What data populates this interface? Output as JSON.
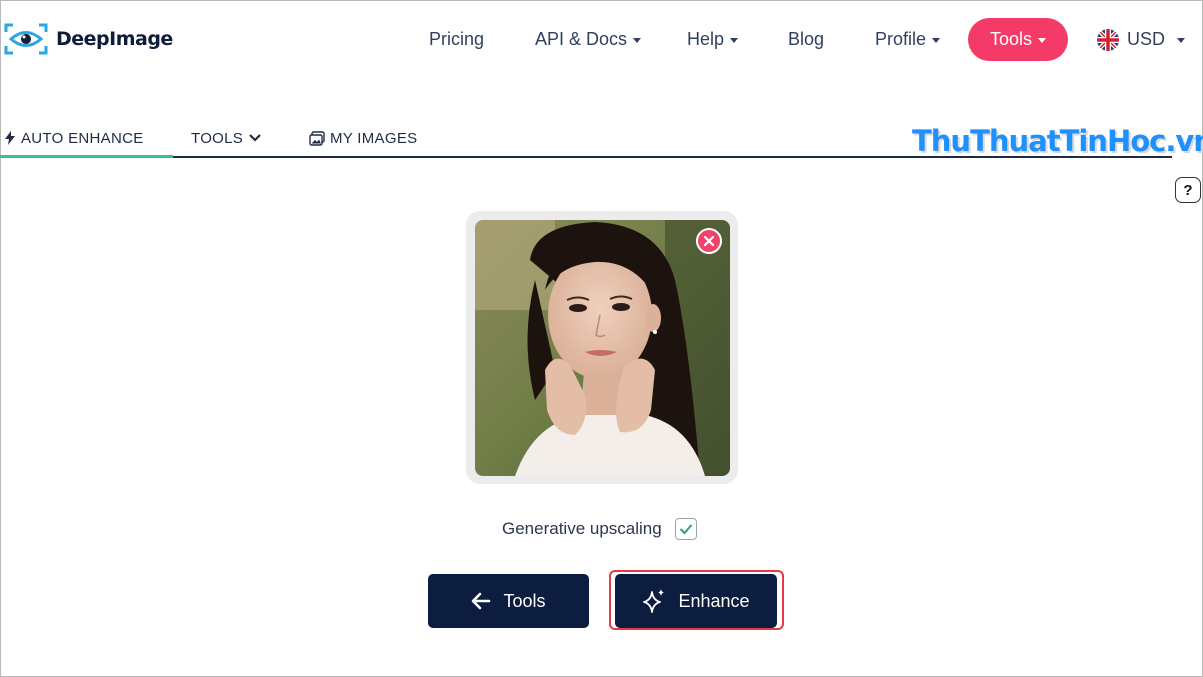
{
  "brand": {
    "name": "DeepImage",
    "accent_color": "#f43b68",
    "dark_color": "#0c1d3f"
  },
  "nav": {
    "pricing": "Pricing",
    "api_docs": "API & Docs",
    "help": "Help",
    "blog": "Blog",
    "profile": "Profile",
    "tools": "Tools",
    "currency": "USD"
  },
  "tabs": {
    "auto_enhance": "AUTO ENHANCE",
    "tools": "TOOLS",
    "my_images": "MY IMAGES"
  },
  "watermark": "ThuThuatTinHoc.vn",
  "help_button": "?",
  "options": {
    "generative_upscaling_label": "Generative upscaling",
    "generative_upscaling_checked": true
  },
  "actions": {
    "back_tools": "Tools",
    "enhance": "Enhance"
  }
}
